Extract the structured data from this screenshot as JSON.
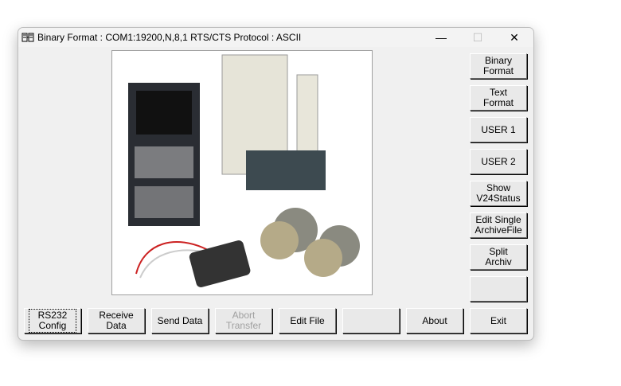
{
  "window": {
    "title": "Binary  Format : COM1:19200,N,8,1 RTS/CTS Protocol : ASCII",
    "controls": {
      "minimize": "—",
      "maximize": "☐",
      "close": "✕"
    }
  },
  "side_buttons": [
    {
      "label": "Binary Format"
    },
    {
      "label": "Text Format"
    },
    {
      "label": "USER 1"
    },
    {
      "label": "USER 2"
    },
    {
      "label": "Show V24Status"
    },
    {
      "label": "Edit Single ArchiveFile"
    },
    {
      "label": "Split Archiv"
    },
    {
      "label": ""
    },
    {
      "label": "Exit"
    }
  ],
  "bottom_buttons": [
    {
      "label": "RS232 Config",
      "focused": true
    },
    {
      "label": "Receive Data"
    },
    {
      "label": "Send Data"
    },
    {
      "label": "Abort Transfer",
      "disabled": true
    },
    {
      "label": "Edit File"
    },
    {
      "label": ""
    },
    {
      "label": "About"
    }
  ],
  "colors": {
    "face": "#f0f0f0",
    "disabled_text": "#a0a0a0"
  }
}
